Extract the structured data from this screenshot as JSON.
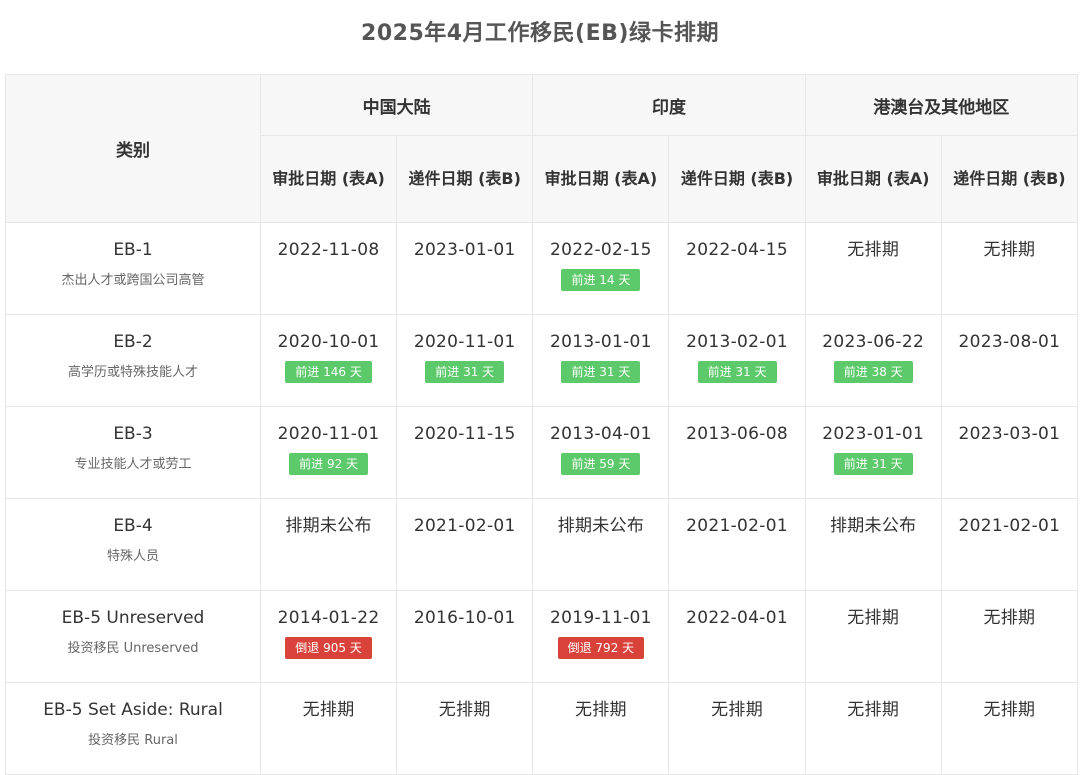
{
  "title": "2025年4月工作移民(EB)绿卡排期",
  "header": {
    "category": "类别",
    "regions": [
      "中国大陆",
      "印度",
      "港澳台及其他地区"
    ],
    "sub_columns": [
      "审批日期 (表A)",
      "递件日期 (表B)",
      "审批日期 (表A)",
      "递件日期 (表B)",
      "审批日期 (表A)",
      "递件日期 (表B)"
    ]
  },
  "colors": {
    "advance_badge": "#5cc96a",
    "retrogress_badge": "#d9423a"
  },
  "rows": [
    {
      "name": "EB-1",
      "desc": "杰出人才或跨国公司高管",
      "cells": [
        {
          "value": "2022-11-08",
          "badge": ""
        },
        {
          "value": "2023-01-01",
          "badge": ""
        },
        {
          "value": "2022-02-15",
          "badge": "前进 14 天",
          "badge_type": "up"
        },
        {
          "value": "2022-04-15",
          "badge": ""
        },
        {
          "value": "无排期",
          "badge": ""
        },
        {
          "value": "无排期",
          "badge": ""
        }
      ]
    },
    {
      "name": "EB-2",
      "desc": "高学历或特殊技能人才",
      "cells": [
        {
          "value": "2020-10-01",
          "badge": "前进 146 天",
          "badge_type": "up"
        },
        {
          "value": "2020-11-01",
          "badge": "前进 31 天",
          "badge_type": "up"
        },
        {
          "value": "2013-01-01",
          "badge": "前进 31 天",
          "badge_type": "up"
        },
        {
          "value": "2013-02-01",
          "badge": "前进 31 天",
          "badge_type": "up"
        },
        {
          "value": "2023-06-22",
          "badge": "前进 38 天",
          "badge_type": "up"
        },
        {
          "value": "2023-08-01",
          "badge": ""
        }
      ]
    },
    {
      "name": "EB-3",
      "desc": "专业技能人才或劳工",
      "cells": [
        {
          "value": "2020-11-01",
          "badge": "前进 92 天",
          "badge_type": "up"
        },
        {
          "value": "2020-11-15",
          "badge": ""
        },
        {
          "value": "2013-04-01",
          "badge": "前进 59 天",
          "badge_type": "up"
        },
        {
          "value": "2013-06-08",
          "badge": ""
        },
        {
          "value": "2023-01-01",
          "badge": "前进 31 天",
          "badge_type": "up"
        },
        {
          "value": "2023-03-01",
          "badge": ""
        }
      ]
    },
    {
      "name": "EB-4",
      "desc": "特殊人员",
      "cells": [
        {
          "value": "排期未公布",
          "badge": ""
        },
        {
          "value": "2021-02-01",
          "badge": ""
        },
        {
          "value": "排期未公布",
          "badge": ""
        },
        {
          "value": "2021-02-01",
          "badge": ""
        },
        {
          "value": "排期未公布",
          "badge": ""
        },
        {
          "value": "2021-02-01",
          "badge": ""
        }
      ]
    },
    {
      "name": "EB-5 Unreserved",
      "desc": "投资移民 Unreserved",
      "cells": [
        {
          "value": "2014-01-22",
          "badge": "倒退 905 天",
          "badge_type": "down"
        },
        {
          "value": "2016-10-01",
          "badge": ""
        },
        {
          "value": "2019-11-01",
          "badge": "倒退 792 天",
          "badge_type": "down"
        },
        {
          "value": "2022-04-01",
          "badge": ""
        },
        {
          "value": "无排期",
          "badge": ""
        },
        {
          "value": "无排期",
          "badge": ""
        }
      ]
    },
    {
      "name": "EB-5 Set Aside: Rural",
      "desc": "投资移民 Rural",
      "cells": [
        {
          "value": "无排期",
          "badge": ""
        },
        {
          "value": "无排期",
          "badge": ""
        },
        {
          "value": "无排期",
          "badge": ""
        },
        {
          "value": "无排期",
          "badge": ""
        },
        {
          "value": "无排期",
          "badge": ""
        },
        {
          "value": "无排期",
          "badge": ""
        }
      ]
    }
  ]
}
